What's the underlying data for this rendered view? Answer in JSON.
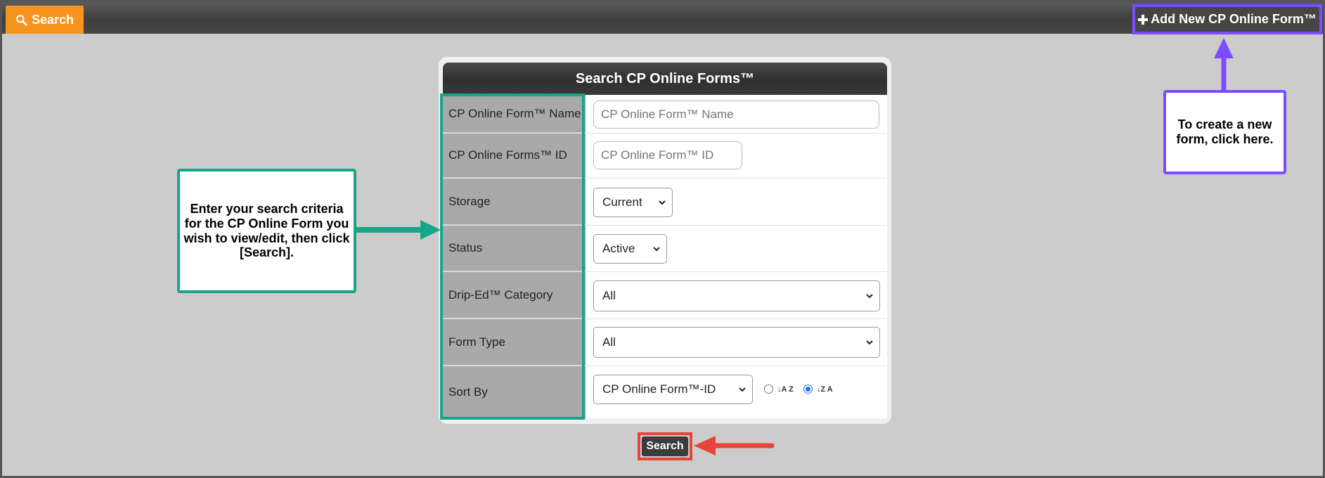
{
  "topbar": {
    "search_tab_label": "Search",
    "add_button_label": "Add New CP Online Form™"
  },
  "panel": {
    "title": "Search CP Online Forms™",
    "fields": {
      "name": {
        "label": "CP Online Form™ Name",
        "placeholder": "CP Online Form™ Name",
        "value": ""
      },
      "id": {
        "label": "CP Online Forms™ ID",
        "placeholder": "CP Online Form™ ID",
        "value": ""
      },
      "storage": {
        "label": "Storage",
        "selected": "Current"
      },
      "status": {
        "label": "Status",
        "selected": "Active"
      },
      "category": {
        "label": "Drip-Ed™ Category",
        "selected": "All"
      },
      "form_type": {
        "label": "Form Type",
        "selected": "All"
      },
      "sort_by": {
        "label": "Sort By",
        "selected": "CP Online Form™-ID",
        "order": "descending",
        "asc_glyph": "↓A Z",
        "desc_glyph": "↓Z A"
      }
    },
    "search_button_label": "Search"
  },
  "callouts": {
    "search_hint": "Enter your search criteria for the CP Online Form you wish to view/edit, then click [Search].",
    "create_hint": "To create a new form, click here."
  },
  "colors": {
    "accent_orange": "#f7931e",
    "highlight_teal": "#17a589",
    "highlight_purple": "#7b4dff",
    "highlight_red": "#e8443b"
  }
}
